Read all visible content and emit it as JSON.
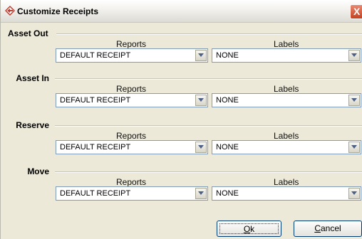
{
  "window": {
    "title": "Customize Receipts",
    "close_label": "X"
  },
  "columns": {
    "reports": "Reports",
    "labels": "Labels"
  },
  "sections": [
    {
      "title": "Asset Out",
      "report": "DEFAULT RECEIPT",
      "label": "NONE"
    },
    {
      "title": "Asset In",
      "report": "DEFAULT RECEIPT",
      "label": "NONE"
    },
    {
      "title": "Reserve",
      "report": "DEFAULT RECEIPT",
      "label": "NONE"
    },
    {
      "title": "Move",
      "report": "DEFAULT RECEIPT",
      "label": "NONE"
    }
  ],
  "buttons": {
    "ok_mnemonic": "O",
    "ok_rest": "k",
    "cancel_mnemonic": "C",
    "cancel_rest": "ancel"
  },
  "colors": {
    "title_icon": "#c0392b",
    "combo_border": "#7f9db9",
    "button_border": "#003c74"
  },
  "icons": {
    "app": "diamond-arrow-icon",
    "dropdown": "chevron-down-icon"
  }
}
